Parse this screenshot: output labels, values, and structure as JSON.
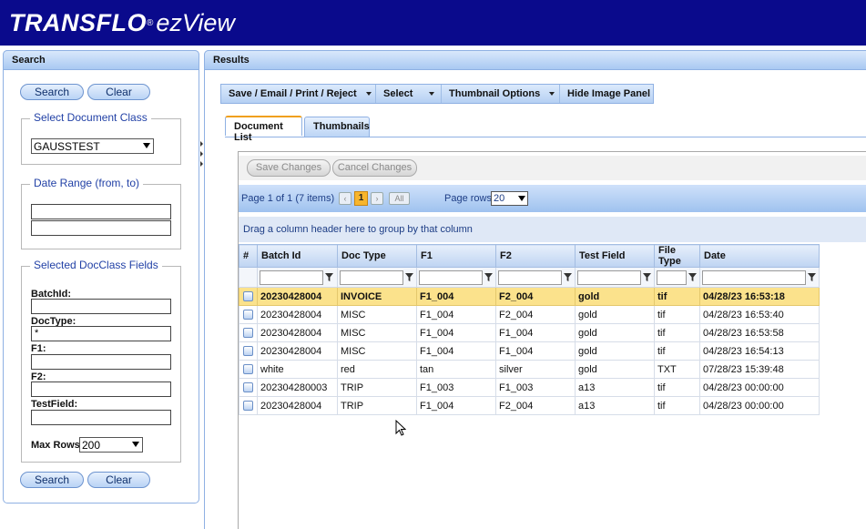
{
  "app": {
    "logo_main": "TRANSFLO",
    "logo_reg": "®",
    "logo_sub": "ezView"
  },
  "search_panel": {
    "title": "Search",
    "search_label": "Search",
    "clear_label": "Clear",
    "doc_class": {
      "legend": "Select Document Class",
      "selected": "GAUSSTEST"
    },
    "date_range": {
      "legend": "Date Range (from, to)",
      "from": "",
      "to": ""
    },
    "fields": {
      "legend": "Selected DocClass Fields",
      "items": [
        {
          "label": "BatchId:",
          "value": ""
        },
        {
          "label": "DocType:",
          "value": "*"
        },
        {
          "label": "F1:",
          "value": ""
        },
        {
          "label": "F2:",
          "value": ""
        },
        {
          "label": "TestField:",
          "value": ""
        }
      ]
    },
    "max_rows": {
      "label": "Max Rows:",
      "selected": "200"
    }
  },
  "results_panel": {
    "title": "Results",
    "toolbar": [
      {
        "label": "Save / Email / Print / Reject"
      },
      {
        "label": "Select"
      },
      {
        "label": "Thumbnail Options"
      },
      {
        "label": "Hide Image Panel"
      }
    ],
    "tabs": [
      {
        "label": "Document List",
        "active": true
      },
      {
        "label": "Thumbnails",
        "active": false
      }
    ],
    "save_changes_label": "Save Changes",
    "cancel_changes_label": "Cancel Changes",
    "pager": {
      "info": "Page 1 of 1 (7 items)",
      "prev": "‹",
      "current_page": "1",
      "next": "›",
      "all_label": "All",
      "page_rows_label": "Page rows",
      "page_rows_value": "20"
    },
    "group_hint": "Drag a column header here to group by that column",
    "columns": [
      "#",
      "Batch Id",
      "Doc Type",
      "F1",
      "F2",
      "Test Field",
      "File Type",
      "Date"
    ],
    "rows": [
      [
        "20230428004",
        "INVOICE",
        "F1_004",
        "F2_004",
        "gold",
        "tif",
        "04/28/23 16:53:18"
      ],
      [
        "20230428004",
        "MISC",
        "F1_004",
        "F2_004",
        "gold",
        "tif",
        "04/28/23 16:53:40"
      ],
      [
        "20230428004",
        "MISC",
        "F1_004",
        "F1_004",
        "gold",
        "tif",
        "04/28/23 16:53:58"
      ],
      [
        "20230428004",
        "MISC",
        "F1_004",
        "F1_004",
        "gold",
        "tif",
        "04/28/23 16:54:13"
      ],
      [
        "white",
        "red",
        "tan",
        "silver",
        "gold",
        "TXT",
        "07/28/23 15:39:48"
      ],
      [
        "202304280003",
        "TRIP",
        "F1_003",
        "F1_003",
        "a13",
        "tif",
        "04/28/23 00:00:00"
      ],
      [
        "20230428004",
        "TRIP",
        "F1_004",
        "F2_004",
        "a13",
        "tif",
        "04/28/23 00:00:00"
      ]
    ],
    "selected_row_index": 0
  },
  "colors": {
    "header_bg": "#0a0a8c",
    "selected_row": "#fbe28c",
    "accent_tab": "#f0a01c"
  }
}
